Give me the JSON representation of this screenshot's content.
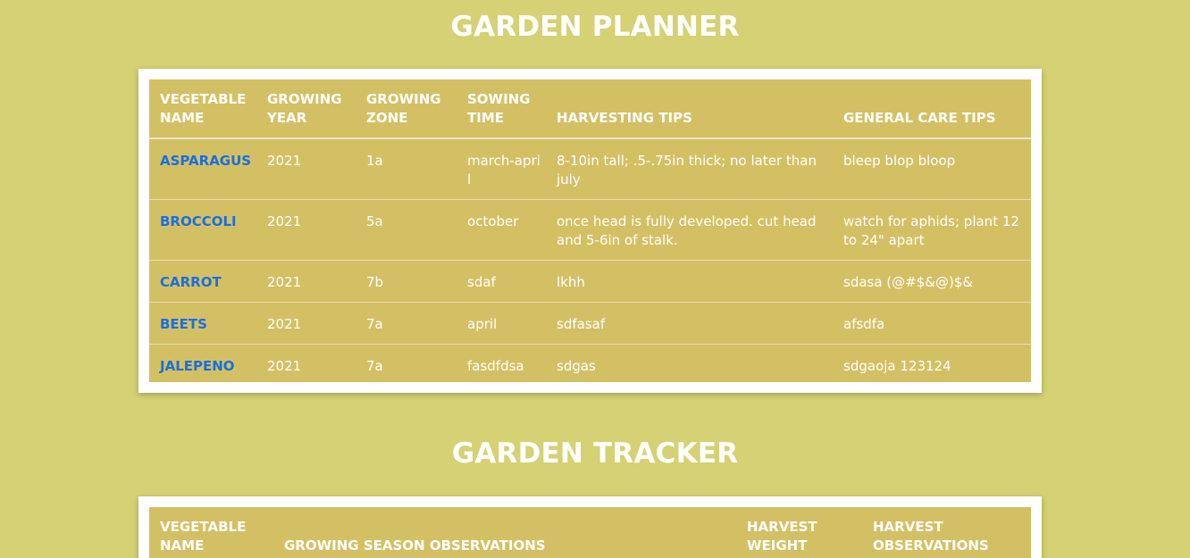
{
  "planner": {
    "title": "GARDEN PLANNER",
    "headers": {
      "vegetable": "VEGETABLE NAME",
      "year": "GROWING YEAR",
      "zone": "GROWING ZONE",
      "sowing": "SOWING TIME",
      "harvesting": "HARVESTING TIPS",
      "care": "GENERAL CARE TIPS"
    },
    "rows": [
      {
        "vegetable": "ASPARAGUS",
        "year": "2021",
        "zone": "1a",
        "sowing": "march-april",
        "harvesting": "8-10in tall; .5-.75in thick; no later than july",
        "care": "bleep blop bloop"
      },
      {
        "vegetable": "BROCCOLI",
        "year": "2021",
        "zone": "5a",
        "sowing": "october",
        "harvesting": "once head is fully developed. cut head and 5-6in of stalk.",
        "care": "watch for aphids; plant 12 to 24\" apart"
      },
      {
        "vegetable": "CARROT",
        "year": "2021",
        "zone": "7b",
        "sowing": "sdaf",
        "harvesting": "lkhh",
        "care": "sdasa (@#$&@)$&"
      },
      {
        "vegetable": "BEETS",
        "year": "2021",
        "zone": "7a",
        "sowing": "april",
        "harvesting": "sdfasaf",
        "care": "afsdfa"
      },
      {
        "vegetable": "JALEPENO",
        "year": "2021",
        "zone": "7a",
        "sowing": "fasdfdsa",
        "harvesting": "sdgas",
        "care": "sdgaoja 123124"
      }
    ]
  },
  "tracker": {
    "title": "GARDEN TRACKER",
    "headers": {
      "vegetable": "VEGETABLE NAME",
      "observations": "GROWING SEASON OBSERVATIONS",
      "weight": "HARVEST WEIGHT",
      "harvest_obs": "HARVEST OBSERVATIONS"
    }
  }
}
